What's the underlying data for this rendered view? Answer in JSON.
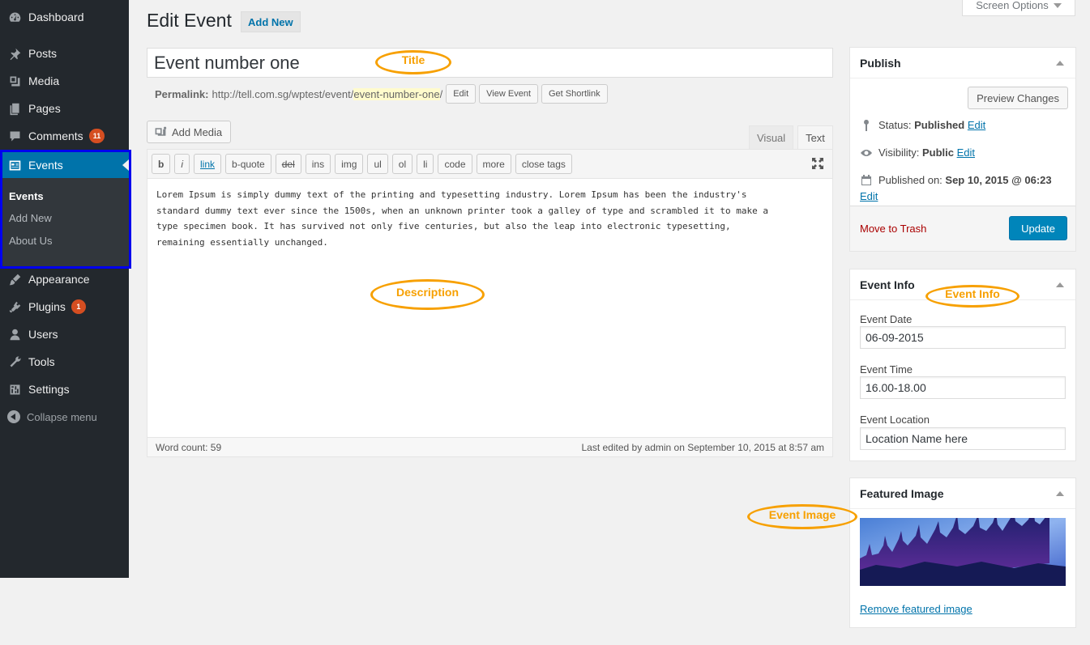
{
  "sidebar": {
    "items": [
      {
        "label": "Dashboard",
        "icon": "dashboard-icon"
      },
      {
        "label": "Posts",
        "icon": "pin-icon"
      },
      {
        "label": "Media",
        "icon": "media-icon"
      },
      {
        "label": "Pages",
        "icon": "pages-icon"
      },
      {
        "label": "Comments",
        "icon": "comment-icon",
        "badge": "11"
      },
      {
        "label": "Events",
        "icon": "events-icon"
      },
      {
        "label": "Appearance",
        "icon": "brush-icon"
      },
      {
        "label": "Plugins",
        "icon": "plugin-icon",
        "badge": "1"
      },
      {
        "label": "Users",
        "icon": "user-icon"
      },
      {
        "label": "Tools",
        "icon": "wrench-icon"
      },
      {
        "label": "Settings",
        "icon": "settings-icon"
      }
    ],
    "events_submenu": [
      "Events",
      "Add New",
      "About Us"
    ],
    "collapse_label": "Collapse menu"
  },
  "header": {
    "title": "Edit Event",
    "add_new": "Add New",
    "screen_options": "Screen Options"
  },
  "post": {
    "title": "Event number one",
    "permalink_label": "Permalink:",
    "permalink_base": "http://tell.com.sg/wptest/event/",
    "permalink_slug": "event-number-one",
    "permalink_trail": "/",
    "permalink_buttons": [
      "Edit",
      "View Event",
      "Get Shortlink"
    ]
  },
  "editor": {
    "add_media": "Add Media",
    "tabs": [
      "Visual",
      "Text"
    ],
    "quicktags": [
      "b",
      "i",
      "link",
      "b-quote",
      "del",
      "ins",
      "img",
      "ul",
      "ol",
      "li",
      "code",
      "more",
      "close tags"
    ],
    "content": "Lorem Ipsum is simply dummy text of the printing and typesetting industry. Lorem Ipsum has been the industry's\nstandard dummy text ever since the 1500s, when an unknown printer took a galley of type and scrambled it to make a\ntype specimen book. It has survived not only five centuries, but also the leap into electronic typesetting,\nremaining essentially unchanged.",
    "word_count": "Word count: 59",
    "last_edited": "Last edited by admin on September 10, 2015 at 8:57 am"
  },
  "publish": {
    "title": "Publish",
    "preview": "Preview Changes",
    "status_label": "Status:",
    "status_value": "Published",
    "visibility_label": "Visibility:",
    "visibility_value": "Public",
    "published_label": "Published on:",
    "published_value": "Sep 10, 2015 @ 06:23",
    "edit": "Edit",
    "trash": "Move to Trash",
    "update": "Update"
  },
  "event_info": {
    "title": "Event Info",
    "date_label": "Event Date",
    "date_value": "06-09-2015",
    "time_label": "Event Time",
    "time_value": "16.00-18.00",
    "location_label": "Event Location",
    "location_value": "Location Name here"
  },
  "featured": {
    "title": "Featured Image",
    "remove": "Remove featured image"
  },
  "annotations": {
    "title": "Title",
    "description": "Description",
    "event_info": "Event Info",
    "event_image": "Event Image"
  },
  "colors": {
    "sidebar_bg": "#23282d",
    "active_blue": "#0073aa",
    "highlight_border": "#0000ee",
    "annotation_orange": "#f7a000",
    "update_button": "#0085ba",
    "badge": "#d54e21"
  }
}
